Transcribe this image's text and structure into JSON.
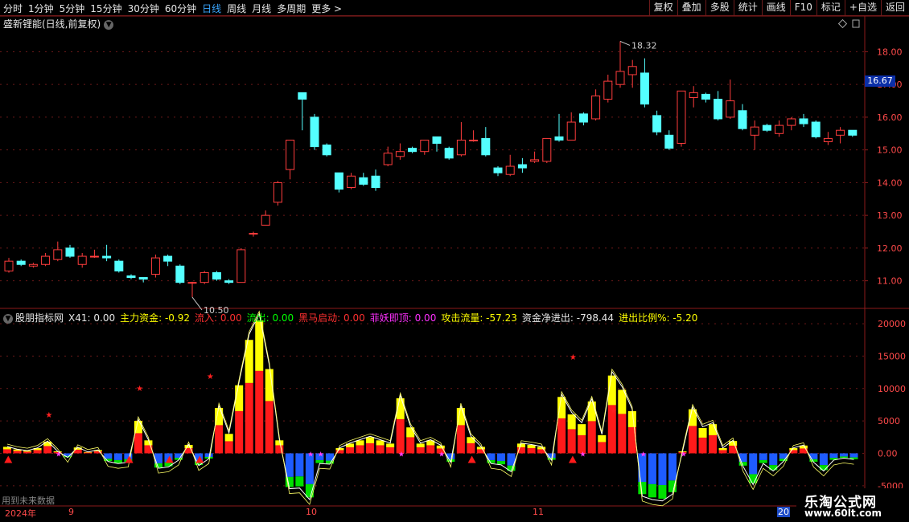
{
  "toolbar": {
    "periods": [
      "分时",
      "1分钟",
      "5分钟",
      "15分钟",
      "30分钟",
      "60分钟",
      "日线",
      "周线",
      "月线",
      "多周期",
      "更多 >"
    ],
    "active_period": "日线",
    "right_buttons": [
      "复权",
      "叠加",
      "多股",
      "统计",
      "画线",
      "F10",
      "标记",
      "+自选",
      "返回"
    ]
  },
  "main_panel": {
    "title": "盛新锂能(日线,前复权)",
    "price_tag": "16.67",
    "high_label": "18.32",
    "low_label": "10.50",
    "y_ticks": [
      "18.00",
      "17.00",
      "16.00",
      "15.00",
      "14.00",
      "13.00",
      "12.00",
      "11.00"
    ]
  },
  "indicator_panel": {
    "name": "股朋指标网",
    "fields": [
      {
        "label": "X41:",
        "value": "0.00",
        "color": "#e6e6e6"
      },
      {
        "label": "主力资金:",
        "value": "-0.92",
        "color": "#ffff00"
      },
      {
        "label": "流入:",
        "value": "0.00",
        "color": "#ff3030"
      },
      {
        "label": "流出:",
        "value": "0.00",
        "color": "#00ff00"
      },
      {
        "label": "黑马启动:",
        "value": "0.00",
        "color": "#ff3030"
      },
      {
        "label": "菲妖即顶:",
        "value": "0.00",
        "color": "#ff30ff"
      },
      {
        "label": "攻击流量:",
        "value": "-57.23",
        "color": "#ffff00"
      },
      {
        "label": "资金净进出:",
        "value": "-798.44",
        "color": "#e6e6e6"
      },
      {
        "label": "进出比例%:",
        "value": "-5.20",
        "color": "#ffff00"
      }
    ],
    "y_ticks": [
      "20000",
      "15000",
      "10000",
      "5000",
      "0.00",
      "-5000"
    ]
  },
  "footer_note": "用到未来数据",
  "date_axis": [
    "2024年",
    "9",
    "10",
    "11",
    "20"
  ],
  "watermark": {
    "line1": "乐淘公式网",
    "line2": "www.60lt.com"
  },
  "colors": {
    "up": "#ff3d3d",
    "down": "#54ffff",
    "yellow": "#ffff00",
    "blue": "#1e5cff",
    "green": "#00e000",
    "axis": "#8b1a1a"
  },
  "chart_data": [
    {
      "type": "candlestick",
      "title": "盛新锂能(日线,前复权)",
      "ylim": [
        10.5,
        18.6
      ],
      "candles": [
        [
          11.3,
          11.6,
          11.7,
          11.25
        ],
        [
          11.6,
          11.5,
          11.65,
          11.45
        ],
        [
          11.45,
          11.5,
          11.55,
          11.4
        ],
        [
          11.5,
          11.75,
          11.85,
          11.45
        ],
        [
          11.65,
          11.95,
          12.2,
          11.6
        ],
        [
          12.0,
          11.75,
          12.1,
          11.7
        ],
        [
          11.5,
          11.75,
          11.85,
          11.4
        ],
        [
          11.75,
          11.75,
          11.95,
          11.7
        ],
        [
          11.75,
          11.7,
          12.1,
          11.6
        ],
        [
          11.6,
          11.3,
          11.65,
          11.25
        ],
        [
          11.15,
          11.1,
          11.2,
          11.05
        ],
        [
          11.1,
          11.05,
          11.1,
          10.95
        ],
        [
          11.2,
          11.7,
          11.8,
          11.1
        ],
        [
          11.75,
          11.6,
          11.8,
          11.45
        ],
        [
          11.45,
          10.95,
          11.5,
          10.9
        ],
        [
          10.95,
          10.95,
          10.97,
          10.5
        ],
        [
          10.95,
          11.25,
          11.3,
          10.9
        ],
        [
          11.25,
          11.05,
          11.3,
          11.0
        ],
        [
          11.0,
          10.95,
          11.05,
          10.9
        ],
        [
          10.95,
          11.95,
          12.0,
          10.95
        ],
        [
          12.45,
          12.45,
          12.5,
          12.35
        ],
        [
          12.7,
          13.0,
          13.15,
          12.7
        ],
        [
          13.4,
          14.0,
          14.05,
          13.3
        ],
        [
          14.4,
          15.3,
          15.3,
          14.1
        ],
        [
          16.75,
          16.55,
          16.75,
          15.6
        ],
        [
          16.0,
          15.1,
          16.1,
          15.0
        ],
        [
          15.15,
          14.85,
          15.2,
          14.8
        ],
        [
          14.3,
          13.8,
          14.3,
          13.7
        ],
        [
          13.85,
          14.2,
          14.3,
          13.8
        ],
        [
          14.15,
          13.95,
          14.3,
          13.9
        ],
        [
          14.2,
          13.85,
          14.4,
          13.75
        ],
        [
          14.55,
          14.9,
          15.1,
          14.5
        ],
        [
          14.8,
          14.95,
          15.2,
          14.7
        ],
        [
          15.05,
          14.95,
          15.1,
          14.9
        ],
        [
          14.95,
          15.3,
          15.3,
          14.85
        ],
        [
          15.4,
          15.2,
          15.4,
          14.95
        ],
        [
          15.05,
          14.75,
          15.1,
          14.7
        ],
        [
          14.85,
          15.3,
          15.85,
          14.8
        ],
        [
          15.3,
          15.3,
          15.6,
          15.25
        ],
        [
          15.35,
          14.85,
          15.7,
          14.8
        ],
        [
          14.45,
          14.3,
          14.5,
          14.2
        ],
        [
          14.25,
          14.5,
          14.85,
          14.2
        ],
        [
          14.55,
          14.45,
          14.75,
          14.3
        ],
        [
          14.65,
          14.7,
          14.95,
          14.6
        ],
        [
          14.65,
          15.35,
          15.35,
          14.6
        ],
        [
          15.4,
          15.3,
          16.1,
          15.25
        ],
        [
          15.3,
          15.85,
          16.15,
          15.3
        ],
        [
          16.1,
          15.85,
          16.15,
          15.75
        ],
        [
          15.95,
          16.65,
          16.85,
          15.9
        ],
        [
          16.55,
          17.1,
          17.3,
          16.45
        ],
        [
          17.0,
          17.4,
          18.32,
          16.9
        ],
        [
          17.3,
          17.55,
          17.75,
          16.9
        ],
        [
          17.35,
          16.4,
          17.8,
          16.3
        ],
        [
          16.05,
          15.55,
          16.2,
          15.45
        ],
        [
          15.45,
          15.05,
          15.6,
          15.0
        ],
        [
          15.2,
          16.8,
          16.8,
          15.1
        ],
        [
          16.6,
          16.75,
          16.95,
          16.3
        ],
        [
          16.7,
          16.55,
          16.75,
          16.45
        ],
        [
          16.55,
          15.95,
          16.8,
          15.9
        ],
        [
          16.0,
          16.5,
          17.15,
          15.95
        ],
        [
          16.2,
          15.65,
          16.4,
          15.6
        ],
        [
          15.45,
          15.7,
          15.9,
          15.0
        ],
        [
          15.75,
          15.6,
          15.8,
          15.55
        ],
        [
          15.5,
          15.75,
          15.9,
          15.4
        ],
        [
          15.75,
          15.95,
          16.0,
          15.6
        ],
        [
          15.95,
          15.8,
          16.1,
          15.7
        ],
        [
          15.85,
          15.4,
          15.9,
          15.35
        ],
        [
          15.25,
          15.35,
          15.55,
          15.15
        ],
        [
          15.45,
          15.6,
          15.7,
          15.2
        ],
        [
          15.6,
          15.45,
          15.6,
          15.4
        ]
      ]
    },
    {
      "type": "bar",
      "title": "股朋指标网",
      "ylim": [
        -7500,
        21000
      ],
      "series": [
        {
          "name": "主力资金",
          "values": [
            1000,
            600,
            400,
            800,
            1800,
            300,
            -600,
            900,
            200,
            500,
            -1200,
            -1500,
            -1300,
            5000,
            2000,
            -2200,
            -2000,
            -1000,
            1300,
            -1800,
            -800,
            7000,
            3000,
            10500,
            17500,
            20500,
            13000,
            2000,
            -5200,
            -5100,
            -6800,
            -1500,
            -1600,
            800,
            1500,
            2000,
            2500,
            2000,
            1500,
            8500,
            4000,
            1500,
            2000,
            1200,
            -1300,
            7000,
            2500,
            1000,
            -1500,
            -1700,
            -2700,
            1500,
            1300,
            1000,
            -1000,
            8700,
            6000,
            4500,
            8000,
            2800,
            12000,
            9800,
            6500,
            -6300,
            -6800,
            -7000,
            -6000,
            300,
            6800,
            3900,
            4500,
            800,
            1900,
            -1900,
            -4600,
            -1500,
            -2600,
            -1200,
            800,
            1200,
            -1300,
            -2600,
            -1000,
            -700,
            -900
          ],
          "color": "#ffff00"
        }
      ]
    }
  ]
}
